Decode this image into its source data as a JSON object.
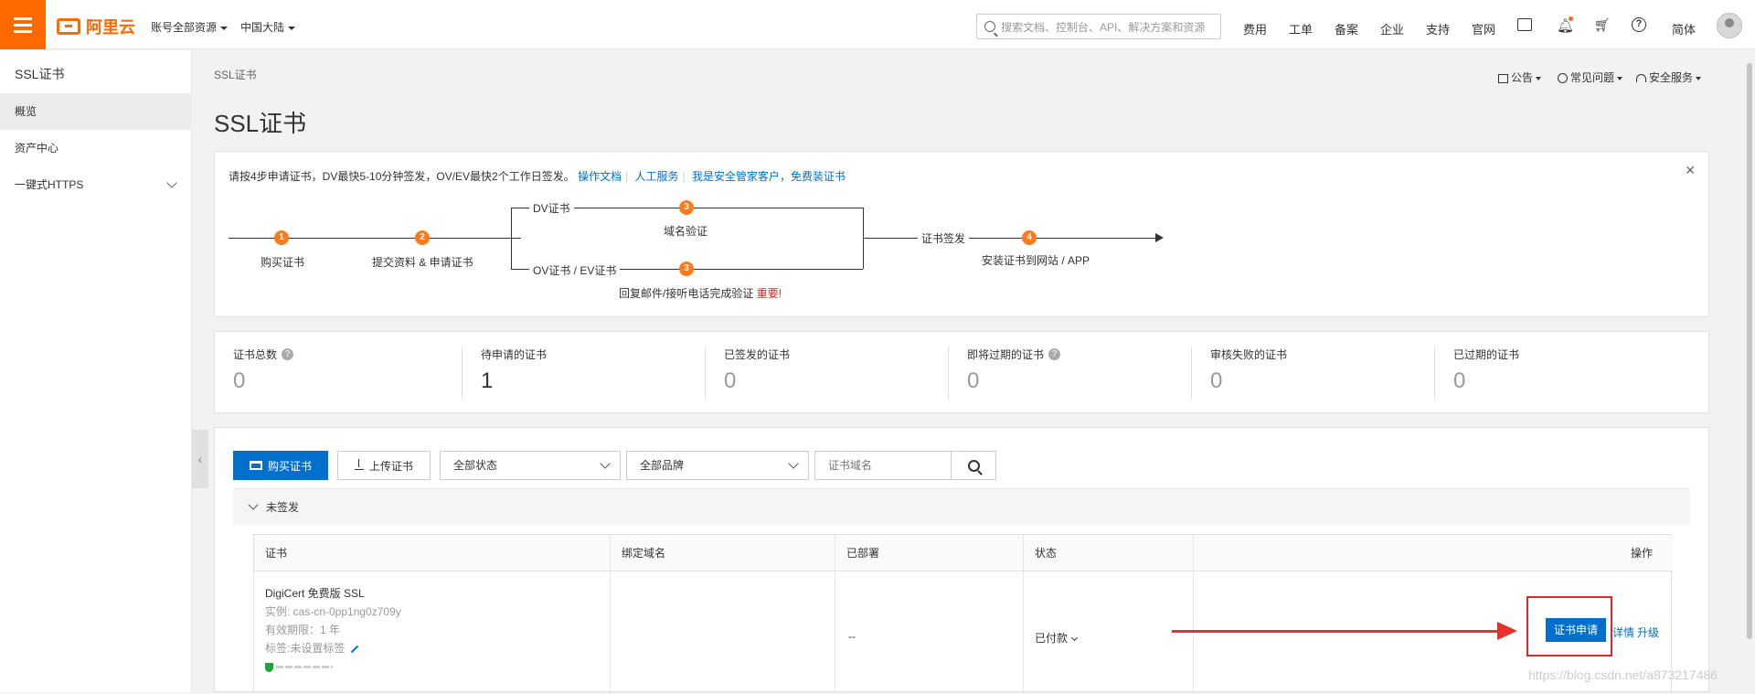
{
  "topbar": {
    "logo_text": "阿里云",
    "account_dropdown": "账号全部资源",
    "region_dropdown": "中国大陆",
    "search_placeholder": "搜索文档、控制台、API、解决方案和资源",
    "links": [
      "费用",
      "工单",
      "备案",
      "企业",
      "支持",
      "官网"
    ],
    "lang": "简体"
  },
  "sidebar": {
    "title": "SSL证书",
    "items": [
      {
        "label": "概览",
        "active": true
      },
      {
        "label": "资产中心",
        "active": false
      },
      {
        "label": "一键式HTTPS",
        "active": false
      }
    ]
  },
  "page": {
    "breadcrumb": "SSL证书",
    "title": "SSL证书",
    "top_links": [
      "公告",
      "常见问题",
      "安全服务"
    ]
  },
  "guide": {
    "intro": "请按4步申请证书，DV最快5-10分钟签发，OV/EV最快2个工作日签发。",
    "links": [
      "操作文档",
      "人工服务",
      "我是安全管家客户，免费装证书"
    ],
    "steps": {
      "s1": "购买证书",
      "s2": "提交资料 & 申请证书",
      "dv": "DV证书",
      "dv_step": "域名验证",
      "ov": "OV证书 / EV证书",
      "ov_step": "回复邮件/接听电话完成验证",
      "important": "重要!",
      "issue": "证书签发",
      "s4": "安装证书到网站 / APP"
    },
    "step_numbers": [
      "1",
      "2",
      "3",
      "3",
      "4"
    ]
  },
  "stats": [
    {
      "label": "证书总数",
      "value": "0",
      "help": true
    },
    {
      "label": "待申请的证书",
      "value": "1",
      "help": false
    },
    {
      "label": "已签发的证书",
      "value": "0",
      "help": false
    },
    {
      "label": "即将过期的证书",
      "value": "0",
      "help": true
    },
    {
      "label": "审核失败的证书",
      "value": "0",
      "help": false
    },
    {
      "label": "已过期的证书",
      "value": "0",
      "help": false
    }
  ],
  "toolbar": {
    "buy_label": "购买证书",
    "upload_label": "上传证书",
    "status_select": "全部状态",
    "brand_select": "全部品牌",
    "domain_placeholder": "证书域名"
  },
  "group": {
    "label": "未签发"
  },
  "table": {
    "headers": [
      "证书",
      "绑定域名",
      "已部署",
      "状态",
      "操作"
    ],
    "row": {
      "name": "DigiCert 免费版 SSL",
      "instance": "实例: cas-cn-0pp1ng0z709y",
      "validity": "有效期限：1 年",
      "tag": "标签:未设置标签",
      "deployed": "--",
      "status": "已付款",
      "action_apply": "证书申请",
      "action_detail": "详情",
      "action_upgrade": "升级"
    }
  },
  "watermark": "https://blog.csdn.net/a873217486",
  "colors": {
    "brand": "#ff6a00",
    "primary": "#0070cc",
    "step": "#ff7a1a",
    "alert": "#e8302a"
  }
}
